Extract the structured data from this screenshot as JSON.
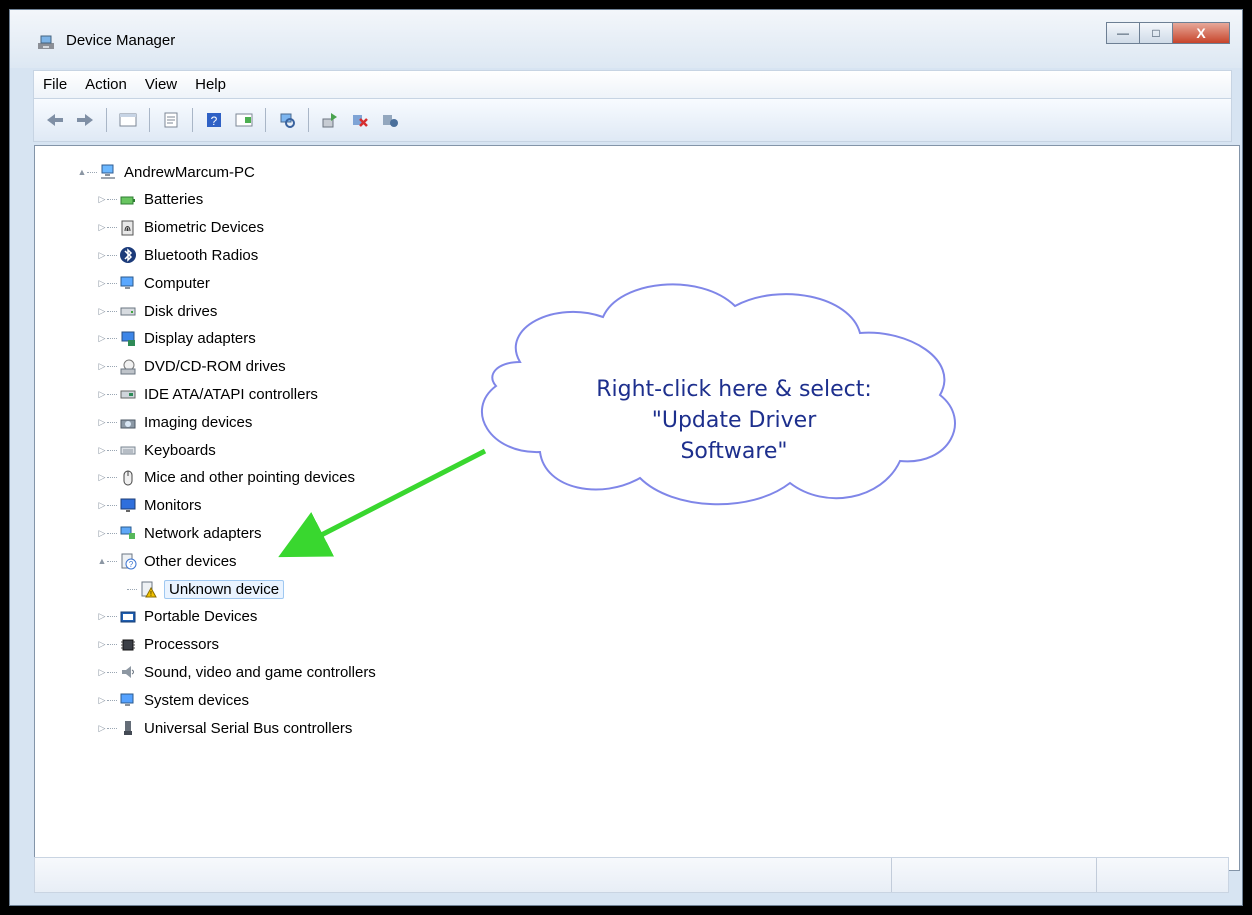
{
  "window": {
    "title": "Device Manager",
    "controls": [
      "minimize",
      "maximize",
      "close"
    ]
  },
  "menu": [
    "File",
    "Action",
    "View",
    "Help"
  ],
  "toolbar": {
    "buttons": [
      "back-arrow-icon",
      "forward-arrow-icon",
      "properties-icon",
      "help-icon",
      "scan-for-hardware-icon",
      "update-driver-icon",
      "uninstall-icon",
      "enable-device-icon"
    ]
  },
  "tree": {
    "root": "AndrewMarcum-PC",
    "categories": [
      {
        "label": "Batteries",
        "icon": "battery-icon",
        "expanded": false
      },
      {
        "label": "Biometric Devices",
        "icon": "fingerprint-icon",
        "expanded": false
      },
      {
        "label": "Bluetooth Radios",
        "icon": "bluetooth-icon",
        "expanded": false
      },
      {
        "label": "Computer",
        "icon": "computer-icon",
        "expanded": false
      },
      {
        "label": "Disk drives",
        "icon": "disk-drive-icon",
        "expanded": false
      },
      {
        "label": "Display adapters",
        "icon": "display-adapter-icon",
        "expanded": false
      },
      {
        "label": "DVD/CD-ROM drives",
        "icon": "dvd-drive-icon",
        "expanded": false
      },
      {
        "label": "IDE ATA/ATAPI controllers",
        "icon": "ide-controller-icon",
        "expanded": false
      },
      {
        "label": "Imaging devices",
        "icon": "camera-icon",
        "expanded": false
      },
      {
        "label": "Keyboards",
        "icon": "keyboard-icon",
        "expanded": false
      },
      {
        "label": "Mice and other pointing devices",
        "icon": "mouse-icon",
        "expanded": false
      },
      {
        "label": "Monitors",
        "icon": "monitor-icon",
        "expanded": false
      },
      {
        "label": "Network adapters",
        "icon": "network-icon",
        "expanded": false
      },
      {
        "label": "Other devices",
        "icon": "unknown-device-icon",
        "expanded": true,
        "children": [
          "Unknown device"
        ]
      },
      {
        "label": "Portable Devices",
        "icon": "portable-device-icon",
        "expanded": false
      },
      {
        "label": "Processors",
        "icon": "processor-icon",
        "expanded": false
      },
      {
        "label": "Sound, video and game controllers",
        "icon": "speaker-icon",
        "expanded": false
      },
      {
        "label": "System devices",
        "icon": "system-device-icon",
        "expanded": false
      },
      {
        "label": "Universal Serial Bus controllers",
        "icon": "usb-icon",
        "expanded": false
      }
    ]
  },
  "annotation": {
    "lines": [
      "Right-click here & select:",
      "\"Update Driver",
      "Software\""
    ],
    "cloud_color": "#7f86e8",
    "arrow_color": "#39d72f",
    "text_color": "#1d2f8d"
  }
}
